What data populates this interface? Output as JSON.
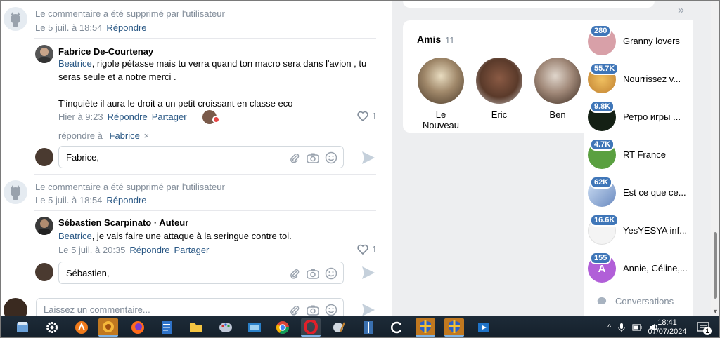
{
  "comments": {
    "deleted1": {
      "text": "Le commentaire a été supprimé par l'utilisateur",
      "date": "Le 5 juil. à 18:54",
      "reply": "Répondre"
    },
    "reply1": {
      "author": "Fabrice De-Courtenay",
      "mention": "Beatrice",
      "text_line1": ", rigole pétasse mais tu verra quand ton macro sera dans l'avion , tu",
      "text_line2": "seras seule et a notre merci .",
      "text_line3": "T'inquiète il aura le droit a un petit croissant en classe eco",
      "date": "Hier à 9:23",
      "reply": "Répondre",
      "share": "Partager",
      "likes": "1"
    },
    "replying_to": {
      "prefix": "répondre à",
      "name": "Fabrice",
      "close": "×"
    },
    "input1_value": "Fabrice,",
    "deleted2": {
      "text": "Le commentaire a été supprimé par l'utilisateur",
      "date": "Le 5 juil. à 18:54",
      "reply": "Répondre"
    },
    "reply2": {
      "author": "Sébastien Scarpinato",
      "role": "· Auteur",
      "mention": "Beatrice",
      "text_line1": ", je vais faire une attaque à la seringue contre toi.",
      "date": "Le 5 juil. à 20:35",
      "reply": "Répondre",
      "share": "Partager",
      "likes": "1"
    },
    "input2_value": "Sébastien,",
    "new_comment_placeholder": "Laissez un commentaire..."
  },
  "friends": {
    "title": "Amis",
    "count": "11",
    "items": [
      {
        "name": "Le Nouveau",
        "color": "#8a7a6a"
      },
      {
        "name": "Eric",
        "color": "#6a4a3a"
      },
      {
        "name": "Ben",
        "color": "#9a8a7a"
      }
    ]
  },
  "groups": [
    {
      "badge": "280",
      "name": "Granny lovers",
      "color": "#d8a0a8"
    },
    {
      "badge": "55.7K",
      "name": "Nourrissez v...",
      "color": "#d9a040"
    },
    {
      "badge": "9.8K",
      "name": "Ретро игры ...",
      "color": "#1a2a1a"
    },
    {
      "badge": "4.7K",
      "name": "RT France",
      "color": "#6aa84f"
    },
    {
      "badge": "62K",
      "name": "Est ce que ce...",
      "color": "#7a9ad0"
    },
    {
      "badge": "16.6K",
      "name": "YesYESYA inf...",
      "color": "#f0f0f0"
    },
    {
      "badge": "155",
      "name": "Annie, Céline,...",
      "color": "#b15fd8"
    }
  ],
  "group_avatar_letter": "A",
  "conversations_label": "Conversations",
  "chevrons": "»",
  "taskbar": {
    "time": "18:41",
    "date": "07/07/2024",
    "notif_count": "1",
    "caret": "^"
  },
  "colors": {
    "link": "#2a5885",
    "muted": "#818c99",
    "badge": "#3f76b8"
  }
}
